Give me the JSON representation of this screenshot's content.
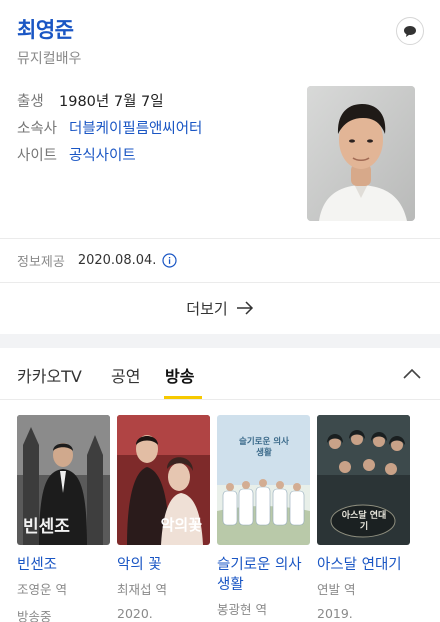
{
  "profile": {
    "name": "최영준",
    "subtitle": "뮤지컬배우",
    "info": [
      {
        "label": "출생",
        "value": "1980년 7월 7일"
      },
      {
        "label": "소속사",
        "value": "더블케이필름앤씨어터"
      },
      {
        "label": "사이트",
        "value": "공식사이트"
      }
    ]
  },
  "source": {
    "label": "정보제공",
    "date": "2020.08.04."
  },
  "more_label": "더보기",
  "tabs": [
    "카카오TV",
    "공연",
    "방송"
  ],
  "active_tab": "방송",
  "colors": {
    "link": "#1a56c4",
    "accent_underline": "#f6c900"
  },
  "works": [
    {
      "title": "빈센조",
      "role": "조영운 역",
      "extra": "방송중",
      "poster_text": "빈센조"
    },
    {
      "title": "악의 꽃",
      "role": "최재섭 역",
      "extra": "2020.",
      "poster_text": "악의꽃"
    },
    {
      "title": "슬기로운 의사생활",
      "role": "봉광현 역",
      "extra": "",
      "poster_text": "슬기로운 의사생활"
    },
    {
      "title": "아스달 연대기",
      "role": "연발 역",
      "extra": "2019.",
      "poster_text": "아스달 연대기"
    }
  ]
}
